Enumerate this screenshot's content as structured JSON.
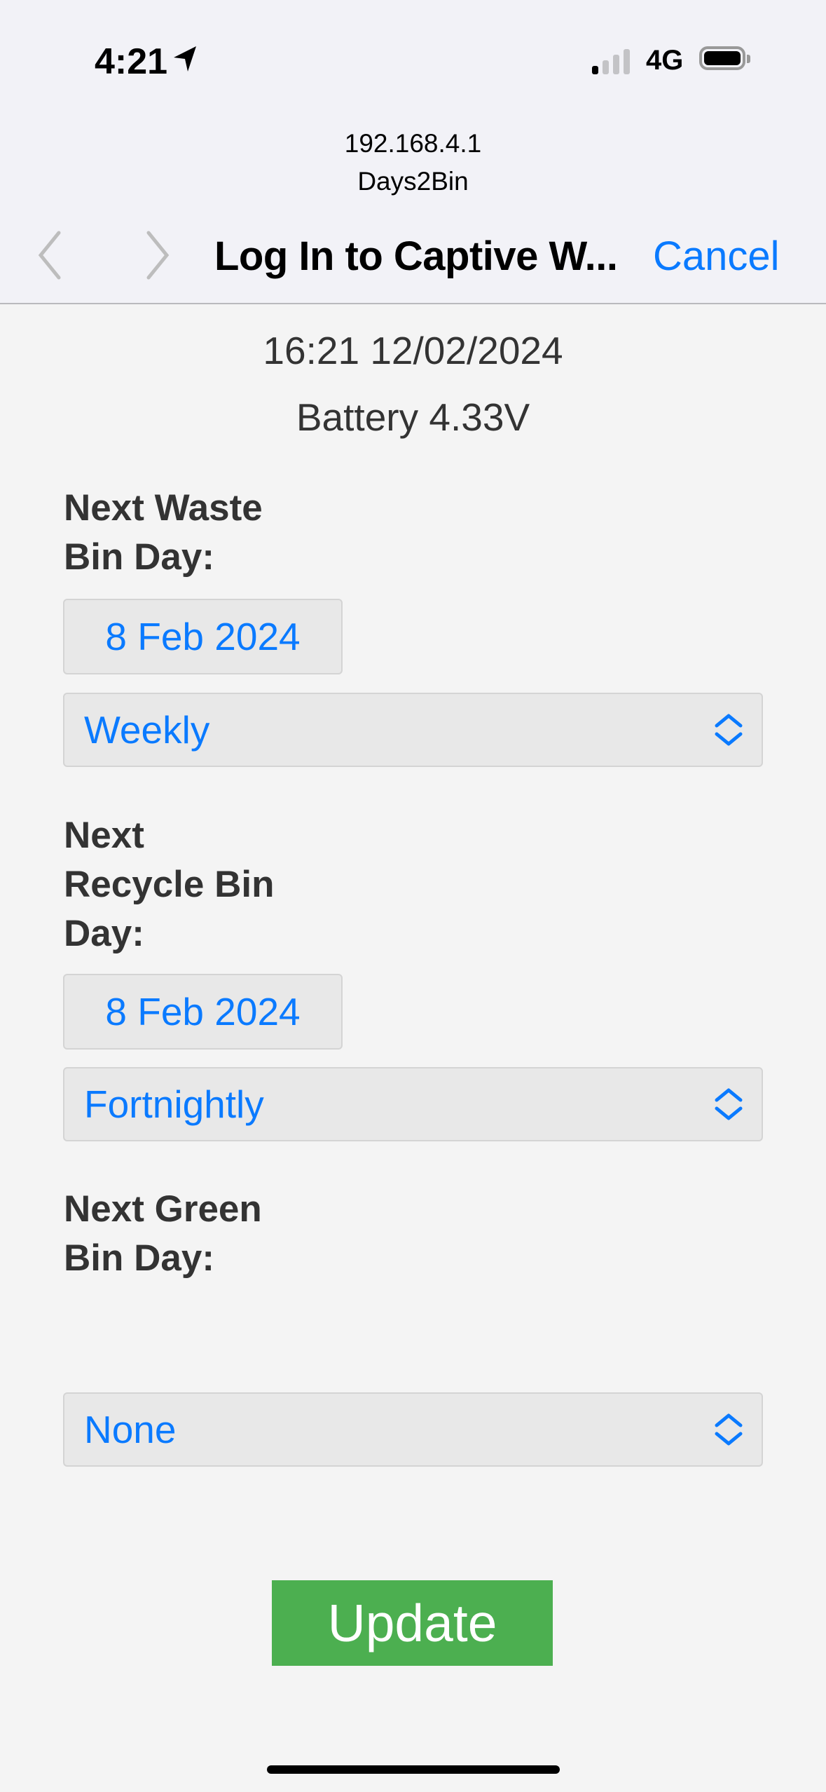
{
  "status_bar": {
    "time": "4:21",
    "network": "4G",
    "icons": [
      "location-arrow-icon",
      "signal-icon",
      "battery-icon"
    ]
  },
  "browser": {
    "url": "192.168.4.1",
    "page_title": "Days2Bin",
    "sheet_title": "Log In to Captive W...",
    "cancel_label": "Cancel"
  },
  "header": {
    "datetime": "16:21 12/02/2024",
    "battery": "Battery 4.33V"
  },
  "waste": {
    "label_line1": "Next Waste",
    "label_line2": "Bin Day:",
    "date": "8 Feb 2024",
    "frequency": "Weekly"
  },
  "recycle": {
    "label_line1": "Next",
    "label_line2": "Recycle Bin",
    "label_line3": "Day:",
    "date": "8 Feb 2024",
    "frequency": "Fortnightly"
  },
  "green": {
    "label_line1": "Next Green",
    "label_line2": "Bin Day:",
    "frequency": "None"
  },
  "update_label": "Update",
  "colors": {
    "accent": "#0a7aff",
    "button": "#4caf50",
    "text": "#333333"
  }
}
